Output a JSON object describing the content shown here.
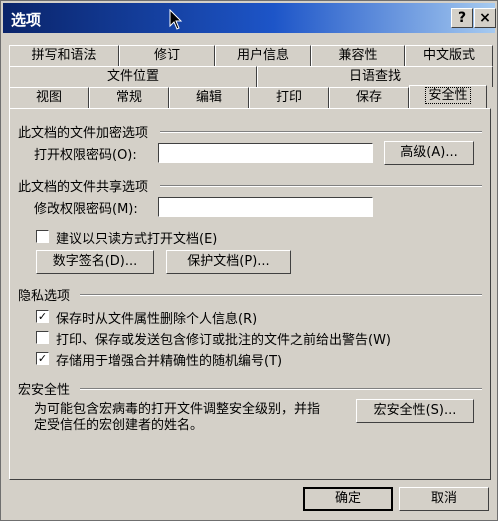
{
  "window": {
    "title": "选项",
    "help_btn": "?",
    "close_btn": "×"
  },
  "tabs": {
    "row1": [
      "拼写和语法",
      "修订",
      "用户信息",
      "兼容性",
      "中文版式"
    ],
    "row2": [
      "文件位置",
      "日语查找"
    ],
    "row3": [
      "视图",
      "常规",
      "编辑",
      "打印",
      "保存",
      "安全性"
    ],
    "active": "安全性"
  },
  "encryption": {
    "heading": "此文档的文件加密选项",
    "open_password_label": "打开权限密码(O):",
    "open_password_value": "",
    "advanced_button": "高级(A)..."
  },
  "sharing": {
    "heading": "此文档的文件共享选项",
    "modify_password_label": "修改权限密码(M):",
    "modify_password_value": "",
    "readonly_label": "建议以只读方式打开文档(E)",
    "readonly_checked": false,
    "digital_signature_button": "数字签名(D)...",
    "protect_document_button": "保护文档(P)..."
  },
  "privacy": {
    "heading": "隐私选项",
    "items": [
      {
        "label": "保存时从文件属性删除个人信息(R)",
        "checked": true
      },
      {
        "label": "打印、保存或发送包含修订或批注的文件之前给出警告(W)",
        "checked": false
      },
      {
        "label": "存储用于增强合并精确性的随机编号(T)",
        "checked": true
      }
    ]
  },
  "macro": {
    "heading": "宏安全性",
    "description_line1": "为可能包含宏病毒的打开文件调整安全级别，并指",
    "description_line2": "定受信任的宏创建者的姓名。",
    "button": "宏安全性(S)..."
  },
  "footer": {
    "ok_button": "确定",
    "cancel_button": "取消"
  }
}
